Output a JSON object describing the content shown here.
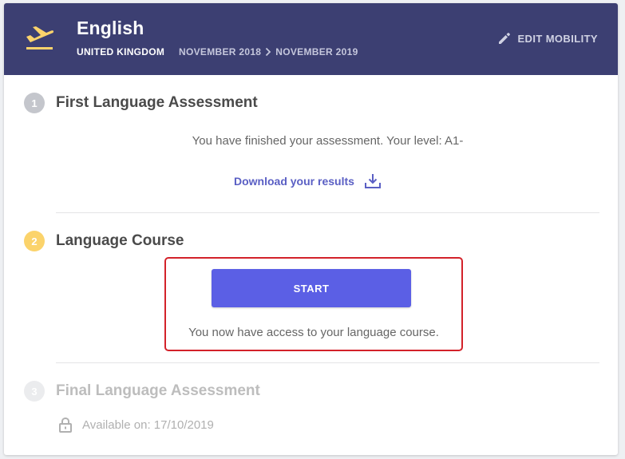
{
  "header": {
    "language": "English",
    "country": "UNITED KINGDOM",
    "date_start": "NOVEMBER 2018",
    "date_end": "NOVEMBER 2019",
    "edit_label": "EDIT MOBILITY",
    "plane_icon": "airplane-takeoff-icon",
    "edit_icon": "pencil-icon"
  },
  "steps": [
    {
      "number": "1",
      "title": "First Language Assessment",
      "status_text": "You have finished your assessment. Your level: A1-",
      "download_label": "Download your results",
      "download_icon": "download-icon"
    },
    {
      "number": "2",
      "title": "Language Course",
      "button_label": "START",
      "status_text": "You now have access to your language course."
    },
    {
      "number": "3",
      "title": "Final Language Assessment",
      "available_text": "Available on: 17/10/2019",
      "lock_icon": "lock-icon"
    }
  ],
  "colors": {
    "header_bg": "#3c3f72",
    "accent_yellow": "#fbd36b",
    "button_blue": "#5b5fe5",
    "link_blue": "#5a5fc4",
    "highlight_red": "#d3222a"
  }
}
